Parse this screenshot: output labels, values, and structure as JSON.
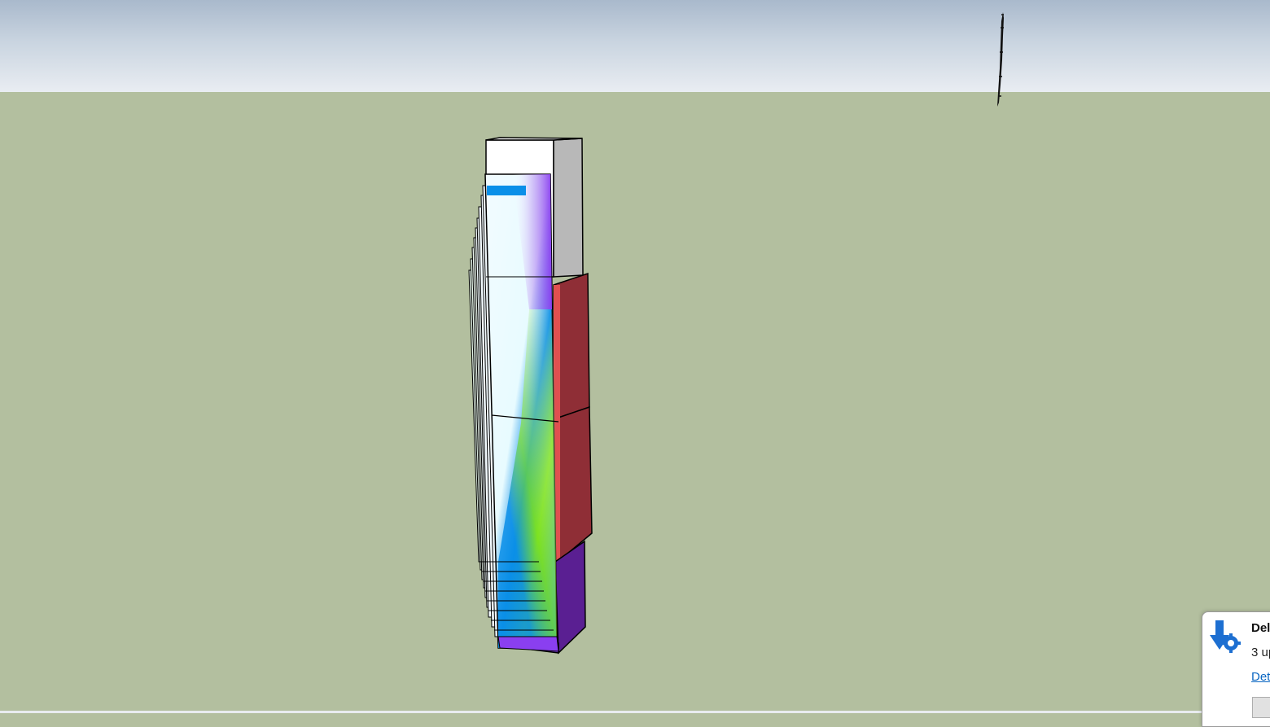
{
  "scene": {
    "sky_color": "#c9d4e0",
    "ground_color": "#b3bf9f",
    "model_colors": {
      "white_block": "#ffffff",
      "gray_side": "#b8b8b8",
      "red_block": "#8f2e36",
      "purple_block": "#5a1f92",
      "purple_plate": "#8a3ff0",
      "blue_plate": "#0a8fe8",
      "green_plate": "#7ee21f"
    },
    "figure_icon": "scale-figure-icon"
  },
  "notification": {
    "icon": "download-gear-icon",
    "title": "Del",
    "body": "3 up",
    "link": "Det",
    "button_label": ""
  }
}
